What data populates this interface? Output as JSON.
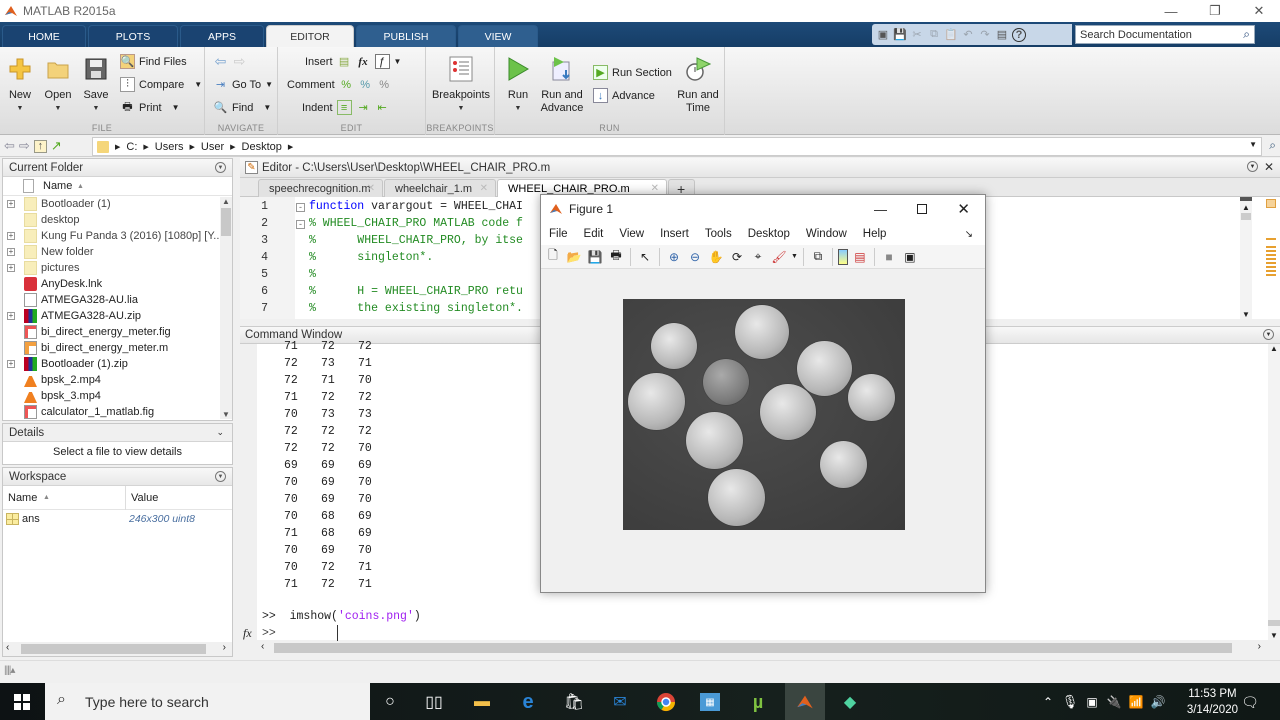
{
  "window": {
    "title": "MATLAB R2015a"
  },
  "ribbon_tabs": [
    {
      "label": "HOME"
    },
    {
      "label": "PLOTS"
    },
    {
      "label": "APPS"
    },
    {
      "label": "EDITOR",
      "active": true
    },
    {
      "label": "PUBLISH"
    },
    {
      "label": "VIEW"
    }
  ],
  "search": {
    "placeholder": "Search Documentation"
  },
  "ribbon": {
    "file": {
      "section_label": "FILE",
      "new": "New",
      "open": "Open",
      "save": "Save",
      "find_files": "Find Files",
      "compare": "Compare",
      "print": "Print"
    },
    "navigate": {
      "section_label": "NAVIGATE",
      "go_to": "Go To",
      "find": "Find"
    },
    "edit": {
      "section_label": "EDIT",
      "insert": "Insert",
      "comment": "Comment",
      "indent": "Indent",
      "fx": "fx"
    },
    "breakpoints": {
      "section_label": "BREAKPOINTS",
      "breakpoints": "Breakpoints"
    },
    "run": {
      "section_label": "RUN",
      "run": "Run",
      "run_and_advance_1": "Run and",
      "run_and_advance_2": "Advance",
      "run_section": "Run Section",
      "advance": "Advance",
      "run_and_time_1": "Run and",
      "run_and_time_2": "Time"
    }
  },
  "address": {
    "path": [
      "C:",
      "Users",
      "User",
      "Desktop"
    ]
  },
  "current_folder": {
    "title": "Current Folder",
    "column_name": "Name",
    "items": [
      {
        "name": "Bootloader (1)",
        "type": "folder",
        "expandable": true
      },
      {
        "name": "desktop",
        "type": "folder",
        "expandable": false
      },
      {
        "name": "Kung Fu Panda 3 (2016) [1080p] [Y...",
        "type": "folder",
        "expandable": true
      },
      {
        "name": "New folder",
        "type": "folder",
        "expandable": true
      },
      {
        "name": "pictures",
        "type": "folder",
        "expandable": true
      },
      {
        "name": "AnyDesk.lnk",
        "type": "anydesk",
        "expandable": false
      },
      {
        "name": "ATMEGA328-AU.lia",
        "type": "file",
        "expandable": false
      },
      {
        "name": "ATMEGA328-AU.zip",
        "type": "zip",
        "expandable": true
      },
      {
        "name": "bi_direct_energy_meter.fig",
        "type": "fig",
        "expandable": false
      },
      {
        "name": "bi_direct_energy_meter.m",
        "type": "mfile",
        "expandable": false
      },
      {
        "name": "Bootloader (1).zip",
        "type": "zip",
        "expandable": true
      },
      {
        "name": "bpsk_2.mp4",
        "type": "vlc",
        "expandable": false
      },
      {
        "name": "bpsk_3.mp4",
        "type": "vlc",
        "expandable": false
      },
      {
        "name": "calculator_1_matlab.fig",
        "type": "fig",
        "expandable": false
      }
    ]
  },
  "details": {
    "title": "Details",
    "message": "Select a file to view details"
  },
  "workspace": {
    "title": "Workspace",
    "columns": [
      "Name",
      "Value"
    ],
    "rows": [
      {
        "name": "ans",
        "value": "246x300 uint8"
      }
    ]
  },
  "editor": {
    "title": "Editor - C:\\Users\\User\\Desktop\\WHEEL_CHAIR_PRO.m",
    "tabs": [
      {
        "label": "speechrecognition.m",
        "active": false
      },
      {
        "label": "wheelchair_1.m",
        "active": false
      },
      {
        "label": "WHEEL_CHAIR_PRO.m",
        "active": true
      }
    ],
    "add_tab": "+",
    "lines": [
      {
        "n": "1",
        "kw": "function",
        "rest": " varargout = WHEEL_CHAI",
        "type": "code"
      },
      {
        "n": "2",
        "text": "% WHEEL_CHAIR_PRO MATLAB code f",
        "type": "comment"
      },
      {
        "n": "3",
        "text": "%      WHEEL_CHAIR_PRO, by itse",
        "type": "comment"
      },
      {
        "n": "4",
        "text": "%      singleton*.",
        "type": "comment"
      },
      {
        "n": "5",
        "text": "%",
        "type": "comment"
      },
      {
        "n": "6",
        "text": "%      H = WHEEL_CHAIR_PRO retu",
        "type": "comment"
      },
      {
        "n": "7",
        "text": "%      the existing singleton*.",
        "type": "comment"
      }
    ]
  },
  "command_window": {
    "title": "Command Window",
    "matrix_rows": [
      [
        "71",
        "72",
        "72"
      ],
      [
        "72",
        "73",
        "71"
      ],
      [
        "72",
        "71",
        "70"
      ],
      [
        "71",
        "72",
        "72"
      ],
      [
        "70",
        "73",
        "73"
      ],
      [
        "72",
        "72",
        "72"
      ],
      [
        "72",
        "72",
        "70"
      ],
      [
        "69",
        "69",
        "69"
      ],
      [
        "70",
        "69",
        "70"
      ],
      [
        "70",
        "69",
        "70"
      ],
      [
        "70",
        "68",
        "69"
      ],
      [
        "71",
        "68",
        "69"
      ],
      [
        "70",
        "69",
        "70"
      ],
      [
        "70",
        "72",
        "71"
      ],
      [
        "71",
        "72",
        "71"
      ]
    ],
    "prompt": ">>",
    "last_command_fn": "imshow(",
    "last_command_arg": "'coins.png'",
    "last_command_end": ")",
    "fx_label": "fx"
  },
  "figure": {
    "title": "Figure 1",
    "menu": [
      "File",
      "Edit",
      "View",
      "Insert",
      "Tools",
      "Desktop",
      "Window",
      "Help"
    ],
    "image_name": "coins.png"
  },
  "taskbar": {
    "search_placeholder": "Type here to search",
    "time": "11:53 PM",
    "date": "3/14/2020"
  },
  "colors": {
    "ribbon_tab_bg": "#1a4371",
    "accent_blue": "#1d4a78",
    "keyword": "#0000ff",
    "comment": "#228b22",
    "string": "#a020f0"
  }
}
